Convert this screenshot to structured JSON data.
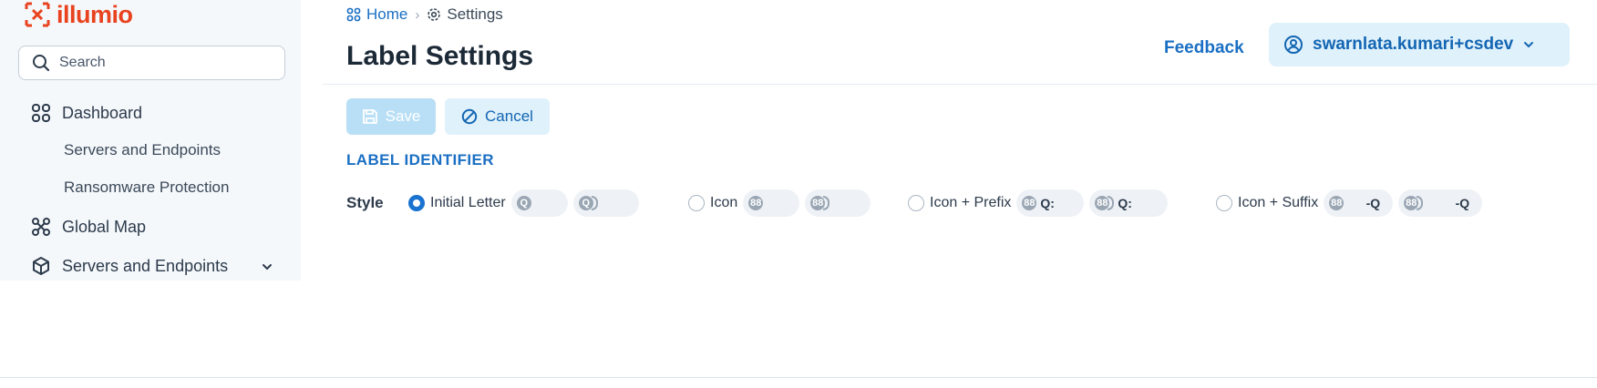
{
  "brand": {
    "name": "illumio",
    "color": "#e8421f",
    "icon": "logo-icon"
  },
  "search": {
    "placeholder": "Search",
    "icon": "search-icon"
  },
  "sidebar": {
    "items": [
      {
        "label": "Dashboard",
        "icon": "dashboard-grid-icon"
      },
      {
        "label": "Servers and Endpoints",
        "sub": true
      },
      {
        "label": "Ransomware Protection",
        "sub": true
      },
      {
        "label": "Global Map",
        "icon": "global-map-icon"
      },
      {
        "label": "Servers and Endpoints",
        "icon": "cube-icon",
        "expandable": true
      }
    ]
  },
  "breadcrumb": {
    "home": "Home",
    "current": "Settings"
  },
  "page": {
    "title": "Label Settings"
  },
  "header": {
    "feedback": "Feedback",
    "user": "swarnlata.kumari+csdev"
  },
  "toolbar": {
    "save_label": "Save",
    "cancel_label": "Cancel"
  },
  "section": {
    "title": "LABEL IDENTIFIER"
  },
  "style": {
    "label": "Style",
    "selected": "Initial Letter",
    "options": [
      {
        "label": "Initial Letter",
        "selected": true,
        "pills": [
          {
            "icon_text": "Q",
            "text": ""
          },
          {
            "icon_text": "Q",
            "text": "",
            "ring": true
          }
        ]
      },
      {
        "label": "Icon",
        "selected": false,
        "pills": [
          {
            "icon_text": "88",
            "text": ""
          },
          {
            "icon_text": "88",
            "text": "",
            "ring": true
          }
        ]
      },
      {
        "label": "Icon + Prefix",
        "selected": false,
        "pills": [
          {
            "icon_text": "88",
            "text": "Q:"
          },
          {
            "icon_text": "88",
            "text": "Q:",
            "ring": true
          }
        ]
      },
      {
        "label": "Icon + Suffix",
        "selected": false,
        "pills": [
          {
            "icon_text": "88",
            "text": "-Q"
          },
          {
            "icon_text": "88",
            "text": "-Q",
            "ring": true
          }
        ]
      }
    ]
  },
  "colors": {
    "accent": "#1a6fc4",
    "radio_on": "#1a73d0",
    "save_disabled": "#b8dff5",
    "sidebar_bg": "#f5f8fb"
  }
}
